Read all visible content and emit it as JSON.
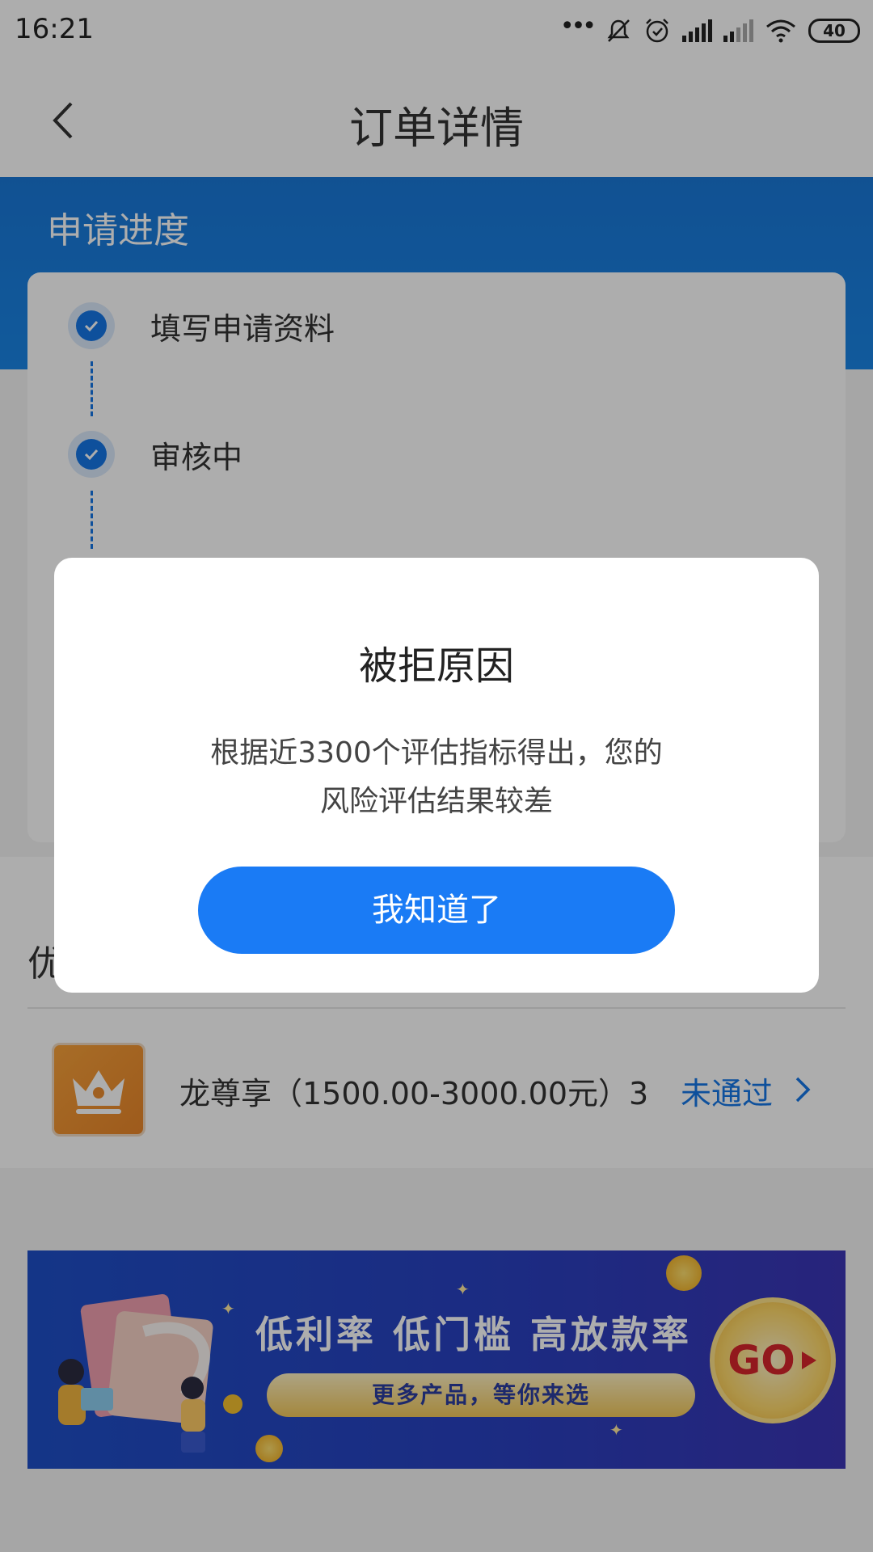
{
  "status_bar": {
    "time": "16:21",
    "battery": "40",
    "icons": [
      "more-dots-icon",
      "mute-icon",
      "alarm-icon",
      "signal-icon",
      "signal-weak-icon",
      "wifi-icon",
      "battery-icon"
    ]
  },
  "nav": {
    "title": "订单详情",
    "back_icon": "back-chevron-icon"
  },
  "progress": {
    "section_title": "申请进度",
    "steps": [
      {
        "label": "填写申请资料",
        "done": true
      },
      {
        "label": "审核中",
        "done": true
      }
    ]
  },
  "offers": {
    "title": "优",
    "product": {
      "name": "龙尊享（1500.00-3000.00元）3...",
      "status": "未通过",
      "icon": "crown-icon"
    }
  },
  "banner": {
    "headline": "低利率 低门槛 高放款率",
    "subline": "更多产品，等你来选",
    "cta": "GO"
  },
  "dialog": {
    "title": "被拒原因",
    "message_line1": "根据近3300个评估指标得出，您的",
    "message_line2": "风险评估结果较差",
    "button": "我知道了"
  },
  "colors": {
    "accent": "#1a7bf5",
    "band": "#1a78d8",
    "status_rejected": "#1677e6"
  }
}
